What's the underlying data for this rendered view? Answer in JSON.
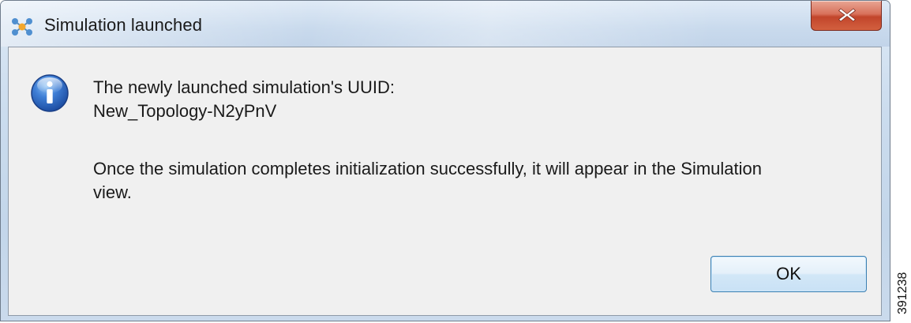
{
  "window": {
    "title": "Simulation launched"
  },
  "icons": {
    "app": "network-topology-icon",
    "close": "close-icon",
    "info": "info-icon"
  },
  "message": {
    "line1": "The newly launched simulation's UUID:",
    "line2": "New_Topology-N2yPnV",
    "line3": "Once the simulation completes initialization successfully, it will appear in the Simulation",
    "line4": "view."
  },
  "buttons": {
    "ok_label": "OK"
  },
  "figure_id": "391238",
  "colors": {
    "close_button": "#c2452b",
    "dialog_background": "#f0f0f0",
    "info_icon_blue": "#2f5fb8"
  }
}
